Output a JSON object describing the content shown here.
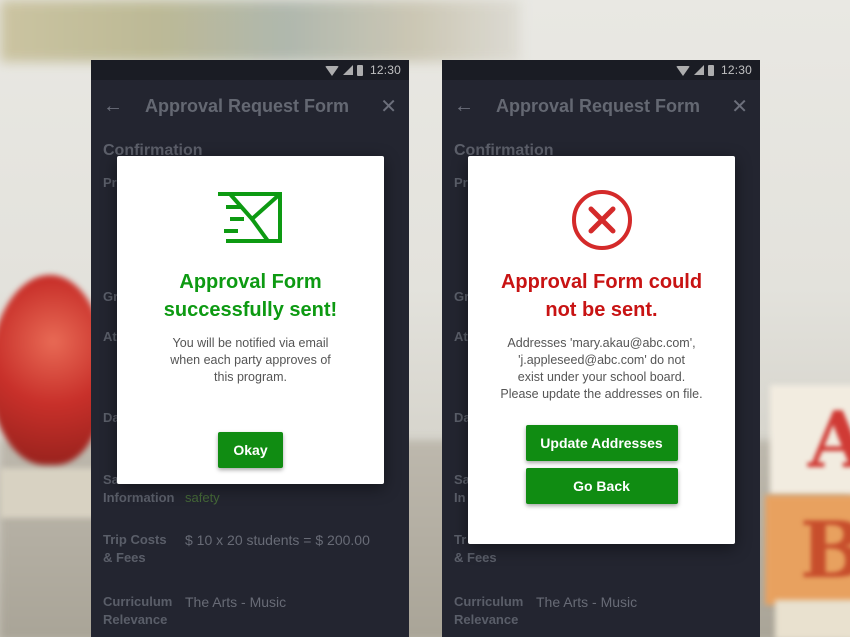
{
  "status_bar": {
    "time": "12:30"
  },
  "form": {
    "title": "Approval Request Form",
    "section": "Confirmation",
    "label_pr": "Pr",
    "label_gr": "Gr",
    "label_at": "At",
    "label_da": "Da",
    "label_sa": "Sa",
    "label_information": "Information",
    "label_in": "In",
    "information_value": "safety",
    "label_trip_costs": "Trip Costs",
    "label_fees": "& Fees",
    "label_tr": "Tr",
    "trip_costs_value": "$ 10 x 20 students = $ 200.00",
    "label_curriculum": "Curriculum",
    "label_relevance": "Relevance",
    "curriculum_value": "The Arts - Music"
  },
  "success_dialog": {
    "title_line1": "Approval Form",
    "title_line2": "successfully sent!",
    "message_line1": "You will be notified via email",
    "message_line2": "when each party approves of",
    "message_line3": "this program.",
    "button_label": "Okay",
    "icon": "mail-sent-icon",
    "color": "#0d9a12"
  },
  "error_dialog": {
    "title_line1": "Approval Form could",
    "title_line2": "not be sent.",
    "message_line1": "Addresses 'mary.akau@abc.com',",
    "message_line2": "'j.appleseed@abc.com' do not",
    "message_line3": "exist under your school board.",
    "message_line4": "Please update the addresses on file.",
    "primary_button": "Update Addresses",
    "secondary_button": "Go Back",
    "icon": "error-x-icon",
    "color": "#c81313"
  },
  "button_color": "#108c12"
}
